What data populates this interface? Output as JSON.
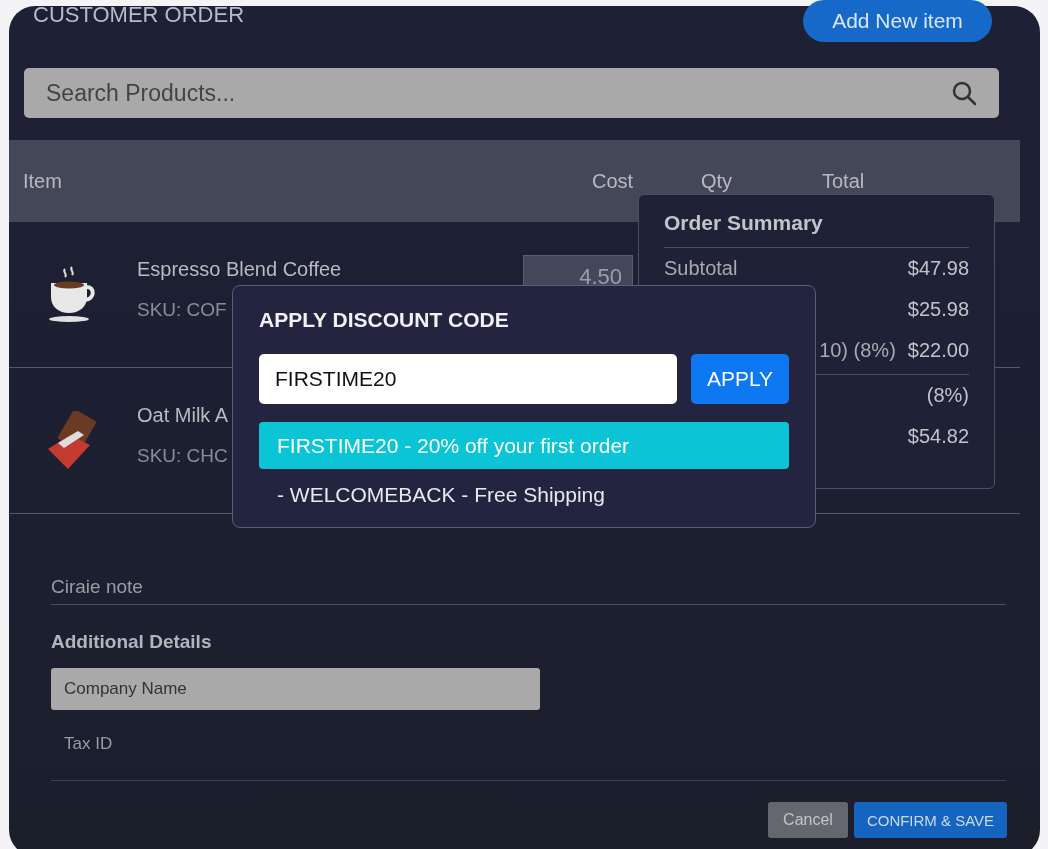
{
  "title": "CUSTOMER ORDER",
  "add_button": "Add New item",
  "search": {
    "placeholder": "Search Products..."
  },
  "table": {
    "columns": [
      "Item",
      "Cost",
      "Qty",
      "Total"
    ],
    "rows": [
      {
        "kind": "coffee",
        "name": "Espresso Blend Coffee",
        "sku": "SKU: COF",
        "cost": "4.50"
      },
      {
        "kind": "chocolate",
        "name": "Oat Milk A",
        "sku": "SKU: CHC"
      }
    ]
  },
  "order_summary": {
    "title": "Order Summary",
    "rows": [
      {
        "label": "Subtotal",
        "value": "$47.98"
      },
      {
        "value": "$25.98"
      },
      {
        "label": "10) (8%)",
        "value": "$22.00",
        "divider_after": true
      },
      {
        "value": "(8%)"
      },
      {
        "value": "$54.82"
      }
    ]
  },
  "discount_dialog": {
    "title": "APPLY DISCOUNT CODE",
    "code_value": "FIRSTIME20",
    "apply_button": "APPLY",
    "suggestions": [
      {
        "text": "FIRSTIME20 - 20% off your first order",
        "selected": true
      },
      {
        "text": "- WELCOMEBACK - Free Shipping",
        "selected": false
      }
    ]
  },
  "note": {
    "placeholder": "Ciraie note"
  },
  "additional_details": {
    "title": "Additional Details",
    "company": {
      "placeholder": "Company Name"
    },
    "tax_id": {
      "placeholder": "Tax ID"
    }
  },
  "buttons": {
    "cancel": "Cancel",
    "confirm": "CONFIRM & SAVE"
  }
}
